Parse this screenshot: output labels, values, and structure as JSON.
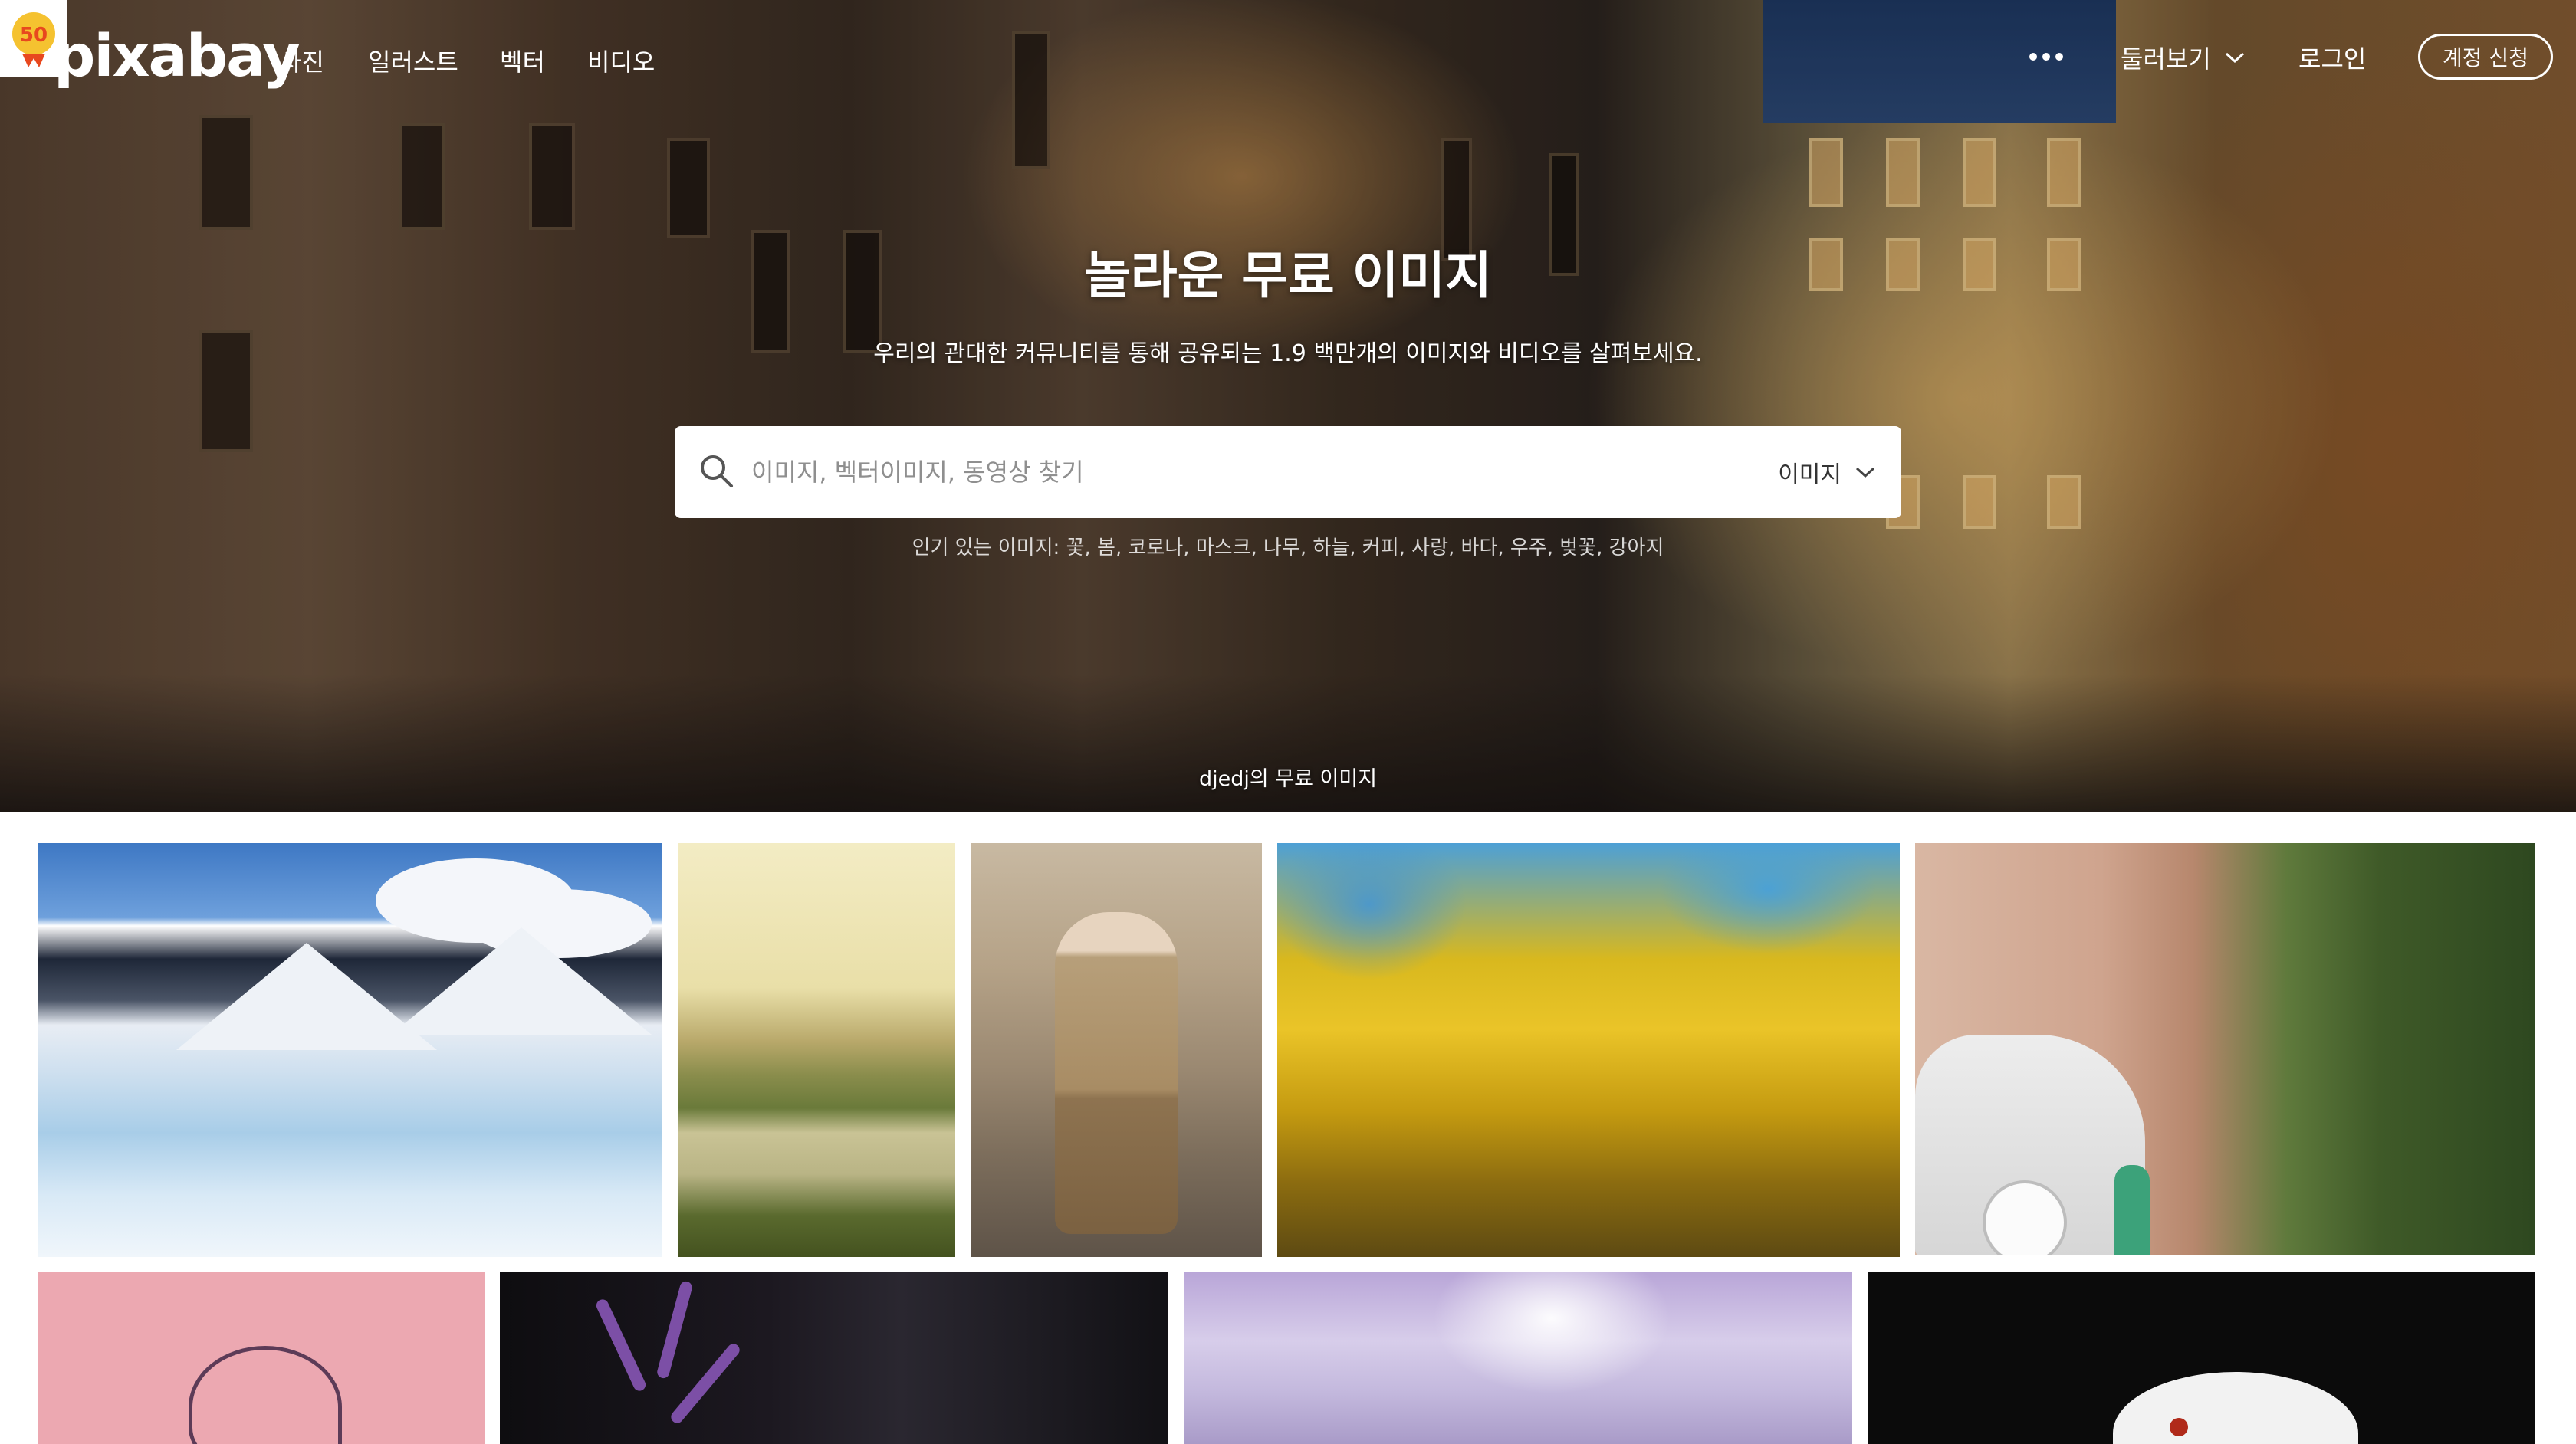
{
  "nav": {
    "logo_text": "pixabay",
    "logo_badge_text": "50",
    "links": [
      "사진",
      "일러스트",
      "벡터",
      "비디오"
    ],
    "more_icon": "more-horizontal-icon",
    "explore_label": "둘러보기",
    "login_label": "로그인",
    "signup_label": "계정 신청"
  },
  "hero": {
    "title": "놀라운 무료 이미지",
    "subtitle": "우리의 관대한 커뮤니티를 통해 공유되는 1.9 백만개의 이미지와 비디오를 살펴보세요.",
    "credit": "djedj의 무료 이미지"
  },
  "search": {
    "placeholder": "이미지, 벡터이미지, 동영상 찾기",
    "value": "",
    "type_label": "이미지",
    "popular_prefix": "인기 있는 이미지:",
    "popular_terms": "꽃, 봄, 코로나, 마스크, 나무, 하늘, 커피, 사랑, 바다, 우주, 벚꽃, 강아지"
  },
  "colors": {
    "accent": "#ffffff",
    "logo_badge": "#e8481e"
  }
}
